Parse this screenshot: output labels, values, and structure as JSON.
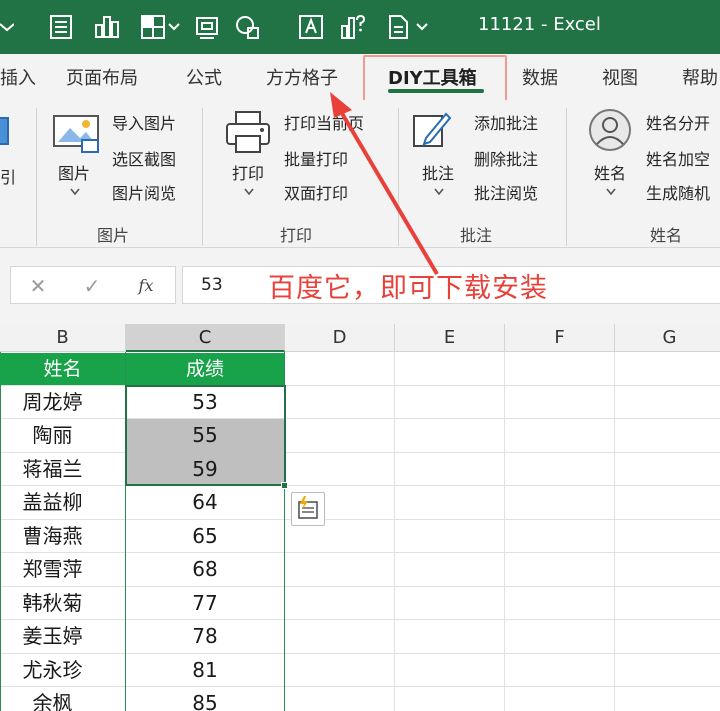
{
  "titlebar": {
    "title": "11121  -  Excel",
    "icons": [
      "quick-access-caret-icon",
      "form-icon",
      "chart-icon",
      "table-icon",
      "paste-values-icon",
      "search-shapes-icon",
      "ocr-icon",
      "chart-question-icon",
      "document-icon"
    ]
  },
  "tabs": [
    {
      "label": "插入"
    },
    {
      "label": "页面布局"
    },
    {
      "label": "公式"
    },
    {
      "label": "方方格子"
    },
    {
      "label": "DIY工具箱"
    },
    {
      "label": "数据"
    },
    {
      "label": "视图"
    },
    {
      "label": "帮助"
    }
  ],
  "ribbon": {
    "group_left": {
      "label": "引"
    },
    "group_picture": {
      "big_label": "图片",
      "items": [
        "导入图片",
        "选区截图",
        "图片阅览"
      ],
      "label": "图片"
    },
    "group_print": {
      "big_label": "打印",
      "items": [
        "打印当前页",
        "批量打印",
        "双面打印"
      ],
      "label": "打印"
    },
    "group_comment": {
      "big_label": "批注",
      "items": [
        "添加批注",
        "删除批注",
        "批注阅览"
      ],
      "label": "批注"
    },
    "group_name": {
      "big_label": "姓名",
      "items": [
        "姓名分开",
        "姓名加空",
        "生成随机"
      ],
      "label": "姓名"
    }
  },
  "formula_bar": {
    "cancel_symbol": "✕",
    "confirm_symbol": "✓",
    "fx_symbol": "fx",
    "value": "53"
  },
  "annotation": "百度它，即可下载安装",
  "sheet": {
    "columns": [
      "B",
      "C",
      "D",
      "E",
      "F",
      "G"
    ],
    "selected_column": "C",
    "header_row": [
      "姓名",
      "成绩"
    ],
    "rows": [
      [
        "周龙婷",
        "53"
      ],
      [
        "陶丽",
        "55"
      ],
      [
        "蒋福兰",
        "59"
      ],
      [
        "盖益柳",
        "64"
      ],
      [
        "曹海燕",
        "65"
      ],
      [
        "郑雪萍",
        "68"
      ],
      [
        "韩秋菊",
        "77"
      ],
      [
        "姜玉婷",
        "78"
      ],
      [
        "尤永珍",
        "81"
      ],
      [
        "余枫",
        "85"
      ]
    ]
  },
  "colors": {
    "excel_green": "#217346",
    "header_green": "#18a34a",
    "annotation_red": "#e8413a",
    "selection_gray": "#bfbfbf"
  }
}
